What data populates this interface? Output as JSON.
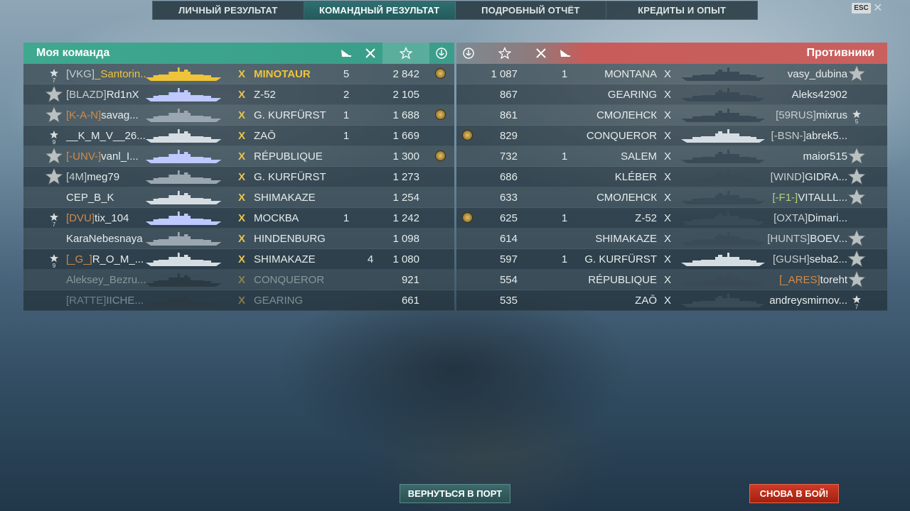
{
  "tabs": [
    {
      "label": "ЛИЧНЫЙ РЕЗУЛЬТАТ",
      "active": false
    },
    {
      "label": "КОМАНДНЫЙ РЕЗУЛЬТАТ",
      "active": true
    },
    {
      "label": "ПОДРОБНЫЙ ОТЧЁТ",
      "active": false
    },
    {
      "label": "КРЕДИТЫ И ОПЫТ",
      "active": false
    }
  ],
  "esc_label": "ESC",
  "close_glyph": "✕",
  "my_team": {
    "title": "Моя команда",
    "rows": [
      {
        "rank": "7",
        "clan": "[VKG]",
        "clan_color": "white",
        "name": "_Santorin...",
        "gold": true,
        "ship": "MINOTAUR",
        "planes": "5",
        "kills": "",
        "exp": "2 842",
        "cap": true,
        "dim": false
      },
      {
        "rank": "big",
        "clan": "[BLAZD]",
        "clan_color": "white",
        "name": "Rd1nX",
        "gold": false,
        "ship": "Z-52",
        "planes": "2",
        "kills": "",
        "exp": "2 105",
        "cap": false,
        "dim": false
      },
      {
        "rank": "big",
        "clan": "[K-A-N]",
        "clan_color": "orange",
        "name": "savag...",
        "gold": false,
        "ship": "G. KURFÜRST",
        "planes": "1",
        "kills": "",
        "exp": "1 688",
        "cap": true,
        "dim": false
      },
      {
        "rank": "9",
        "clan": "",
        "clan_color": "white",
        "name": "__K_M_V__26...",
        "gold": false,
        "ship": "ZAŌ",
        "planes": "1",
        "kills": "",
        "exp": "1 669",
        "cap": false,
        "dim": false
      },
      {
        "rank": "big",
        "clan": "[-UNV-]",
        "clan_color": "orange",
        "name": "vanl_I...",
        "gold": false,
        "ship": "RÉPUBLIQUE",
        "planes": "",
        "kills": "",
        "exp": "1 300",
        "cap": true,
        "dim": false
      },
      {
        "rank": "big",
        "clan": "[4M]",
        "clan_color": "white",
        "name": "meg79",
        "gold": false,
        "ship": "G. KURFÜRST",
        "planes": "",
        "kills": "",
        "exp": "1 273",
        "cap": false,
        "dim": false
      },
      {
        "rank": "",
        "clan": "",
        "clan_color": "white",
        "name": "CEP_B_K",
        "gold": false,
        "ship": "SHIMAKAZE",
        "planes": "",
        "kills": "",
        "exp": "1 254",
        "cap": false,
        "dim": false
      },
      {
        "rank": "7",
        "clan": "[DVU]",
        "clan_color": "orange",
        "name": "tix_104",
        "gold": false,
        "ship": "МОСКВА",
        "planes": "1",
        "kills": "",
        "exp": "1 242",
        "cap": false,
        "dim": false
      },
      {
        "rank": "",
        "clan": "",
        "clan_color": "white",
        "name": "KaraNebesnaya",
        "gold": false,
        "ship": "HINDENBURG",
        "planes": "",
        "kills": "",
        "exp": "1 098",
        "cap": false,
        "dim": false
      },
      {
        "rank": "9",
        "clan": "[_G_]",
        "clan_color": "orange",
        "name": "R_O_M_...",
        "gold": false,
        "ship": "SHIMAKAZE",
        "planes": "",
        "kills": "4",
        "exp": "1 080",
        "cap": false,
        "dim": false
      },
      {
        "rank": "",
        "clan": "",
        "clan_color": "white",
        "name": "Aleksey_Bezru...",
        "gold": false,
        "ship": "CONQUEROR",
        "planes": "",
        "kills": "",
        "exp": "921",
        "cap": false,
        "dim": true
      },
      {
        "rank": "",
        "clan": "[RATTE]",
        "clan_color": "white",
        "name": "IICHE...",
        "gold": false,
        "ship": "GEARING",
        "planes": "",
        "kills": "",
        "exp": "661",
        "cap": false,
        "dim": true
      }
    ]
  },
  "enemy_team": {
    "title": "Противники",
    "rows": [
      {
        "rank": "big",
        "clan": "",
        "clan_color": "white",
        "name": "vasy_dubina",
        "ship": "MONTANA",
        "planes": "1",
        "exp": "1 087",
        "cap": false,
        "dim": false
      },
      {
        "rank": "",
        "clan": "",
        "clan_color": "white",
        "name": "Aleks42902",
        "ship": "GEARING",
        "planes": "",
        "exp": "867",
        "cap": false,
        "dim": false
      },
      {
        "rank": "5",
        "clan": "[59RUS]",
        "clan_color": "white",
        "name": "mixrus",
        "ship": "СМОЛЕНСК",
        "planes": "",
        "exp": "861",
        "cap": false,
        "dim": false
      },
      {
        "rank": "",
        "clan": "[-BSN-]",
        "clan_color": "white",
        "name": "abrek5...",
        "ship": "CONQUEROR",
        "planes": "",
        "exp": "829",
        "cap": true,
        "dim": false
      },
      {
        "rank": "big",
        "clan": "",
        "clan_color": "white",
        "name": "maior515",
        "ship": "SALEM",
        "planes": "1",
        "exp": "732",
        "cap": false,
        "dim": false
      },
      {
        "rank": "big",
        "clan": "[WIND]",
        "clan_color": "white",
        "name": "GIDRA...",
        "ship": "KLÉBER",
        "planes": "",
        "exp": "686",
        "cap": false,
        "dim": false
      },
      {
        "rank": "big",
        "clan": "[-F1-]",
        "clan_color": "green",
        "name": "VITALLL...",
        "ship": "СМОЛЕНСК",
        "planes": "",
        "exp": "633",
        "cap": false,
        "dim": false
      },
      {
        "rank": "",
        "clan": "[OXTA]",
        "clan_color": "white",
        "name": "Dimari...",
        "ship": "Z-52",
        "planes": "1",
        "exp": "625",
        "cap": true,
        "dim": false
      },
      {
        "rank": "big",
        "clan": "[HUNTS]",
        "clan_color": "white",
        "name": "BOEV...",
        "ship": "SHIMAKAZE",
        "planes": "",
        "exp": "614",
        "cap": false,
        "dim": false
      },
      {
        "rank": "big",
        "clan": "[GUSH]",
        "clan_color": "white",
        "name": "seba2...",
        "ship": "G. KURFÜRST",
        "planes": "1",
        "exp": "597",
        "cap": false,
        "dim": false
      },
      {
        "rank": "big",
        "clan": "[_ARES]",
        "clan_color": "orange",
        "name": "toreht",
        "ship": "RÉPUBLIQUE",
        "planes": "",
        "exp": "554",
        "cap": false,
        "dim": false
      },
      {
        "rank": "7",
        "clan": "",
        "clan_color": "white",
        "name": "andreysmirnov...",
        "ship": "ZAŌ",
        "planes": "",
        "exp": "535",
        "cap": false,
        "dim": false
      }
    ]
  },
  "x_label": "X",
  "buttons": {
    "port": "ВЕРНУТЬСЯ В ПОРТ",
    "battle": "СНОВА В БОЙ!"
  },
  "colors": {
    "my_team_header": "#3fa88f",
    "enemy_header": "#c85c5a",
    "gold": "#f0c43a",
    "battle_button": "#c02e1a"
  }
}
